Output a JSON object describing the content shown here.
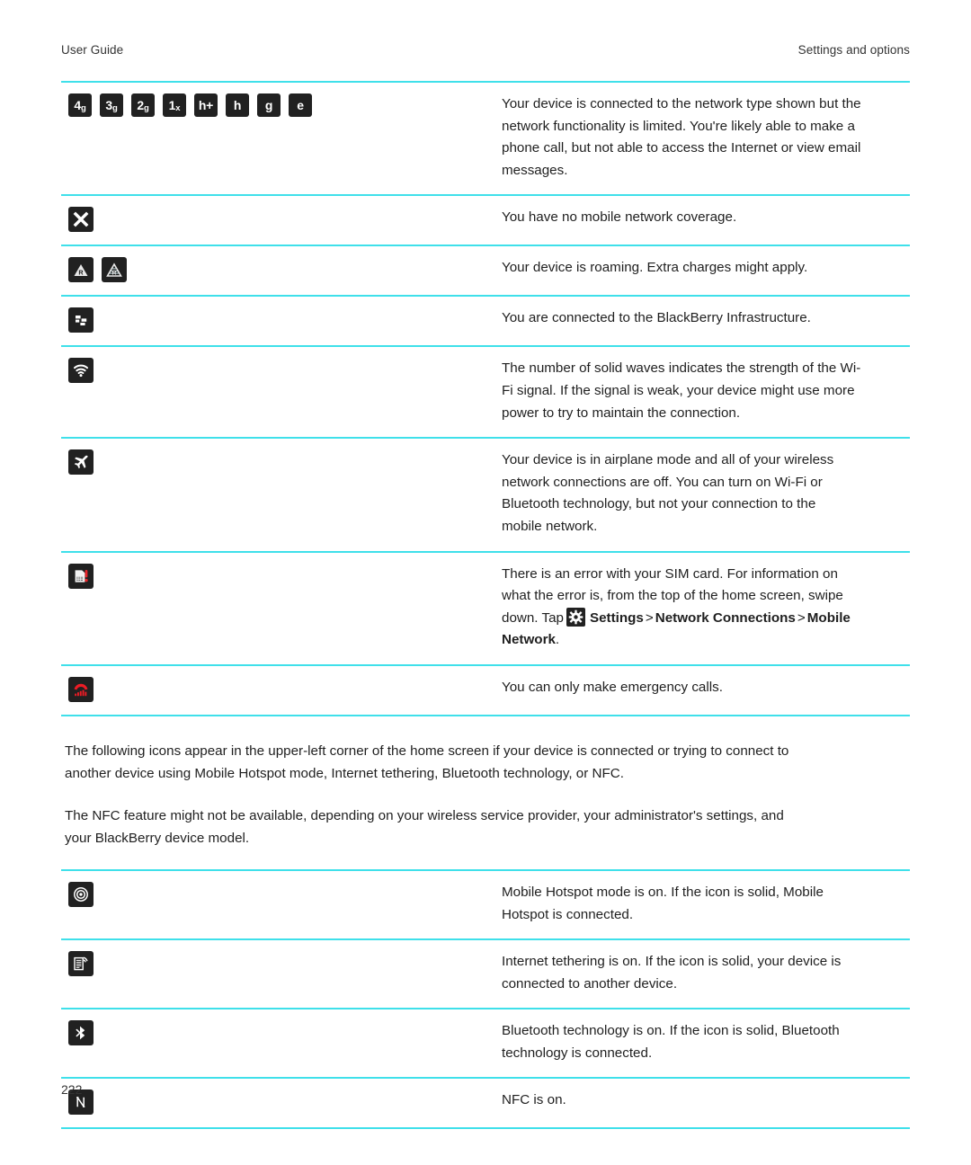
{
  "header": {
    "left": "User Guide",
    "right": "Settings and options"
  },
  "table_one": {
    "rows": [
      {
        "icons": [
          {
            "name": "network-4g-icon",
            "label": "4",
            "sub": "g"
          },
          {
            "name": "network-3g-icon",
            "label": "3",
            "sub": "g"
          },
          {
            "name": "network-2g-icon",
            "label": "2",
            "sub": "g"
          },
          {
            "name": "network-1x-icon",
            "label": "1",
            "sub": "x"
          },
          {
            "name": "network-hplus-icon",
            "label": "h+",
            "sub": ""
          },
          {
            "name": "network-h-icon",
            "label": "h",
            "sub": ""
          },
          {
            "name": "network-g-icon",
            "label": "g",
            "sub": ""
          },
          {
            "name": "network-e-icon",
            "label": "e",
            "sub": ""
          }
        ],
        "lines": [
          "Your device is connected to the network type shown but the",
          "network functionality is limited. You're likely able to make a",
          "phone call, but not able to access the Internet or view email",
          "messages."
        ]
      },
      {
        "icons": [
          {
            "name": "no-coverage-icon"
          }
        ],
        "lines": [
          "You have no mobile network coverage."
        ]
      },
      {
        "icons": [
          {
            "name": "roaming-icon"
          },
          {
            "name": "roaming-outline-icon"
          }
        ],
        "lines": [
          "Your device is roaming. Extra charges might apply."
        ]
      },
      {
        "icons": [
          {
            "name": "blackberry-infrastructure-icon"
          }
        ],
        "lines": [
          "You are connected to the BlackBerry Infrastructure."
        ]
      },
      {
        "icons": [
          {
            "name": "wifi-icon"
          }
        ],
        "lines": [
          "The number of solid waves indicates the strength of the Wi-",
          "Fi signal. If the signal is weak, your device might use more",
          "power to try to maintain the connection."
        ]
      },
      {
        "icons": [
          {
            "name": "airplane-mode-icon"
          }
        ],
        "lines": [
          "Your device is in airplane mode and all of your wireless",
          "network connections are off. You can turn on Wi-Fi or",
          "Bluetooth technology, but not your connection to the",
          "mobile network."
        ]
      },
      {
        "icons": [
          {
            "name": "sim-card-error-icon"
          }
        ],
        "lines": [
          "There is an error with your SIM card. For information on",
          "what the error is, from the top of the home screen, swipe"
        ],
        "nav": {
          "prefix": "down. Tap",
          "gear_icon": "settings-gear-icon",
          "step1": "Settings",
          "sep1": ">",
          "step2": "Network Connections",
          "sep2": ">",
          "step3": "Mobile",
          "step4": "Network",
          "period": "."
        }
      },
      {
        "icons": [
          {
            "name": "emergency-calls-icon"
          }
        ],
        "lines": [
          "You can only make emergency calls."
        ]
      }
    ]
  },
  "paragraphs": [
    [
      "The following icons appear in the upper-left corner of the home screen if your device is connected or trying to connect to",
      "another device using Mobile Hotspot mode, Internet tethering, Bluetooth technology, or NFC."
    ],
    [
      "The NFC feature might not be available, depending on your wireless service provider, your administrator's settings, and",
      "your BlackBerry device model."
    ]
  ],
  "table_two": {
    "rows": [
      {
        "icons": [
          {
            "name": "mobile-hotspot-icon"
          }
        ],
        "lines": [
          "Mobile Hotspot mode is on. If the icon is solid, Mobile",
          "Hotspot is connected."
        ]
      },
      {
        "icons": [
          {
            "name": "internet-tethering-icon"
          }
        ],
        "lines": [
          "Internet tethering is on. If the icon is solid, your device is",
          "connected to another device."
        ]
      },
      {
        "icons": [
          {
            "name": "bluetooth-icon"
          }
        ],
        "lines": [
          "Bluetooth technology is on. If the icon is solid, Bluetooth",
          "technology is connected."
        ]
      },
      {
        "icons": [
          {
            "name": "nfc-icon"
          }
        ],
        "lines": [
          "NFC is on."
        ]
      }
    ]
  },
  "folio": "222",
  "colors": {
    "rule": "#3fe0ea",
    "tile_bg": "#212121",
    "alert_red": "#e8242a",
    "text": "#1f1f1f"
  }
}
